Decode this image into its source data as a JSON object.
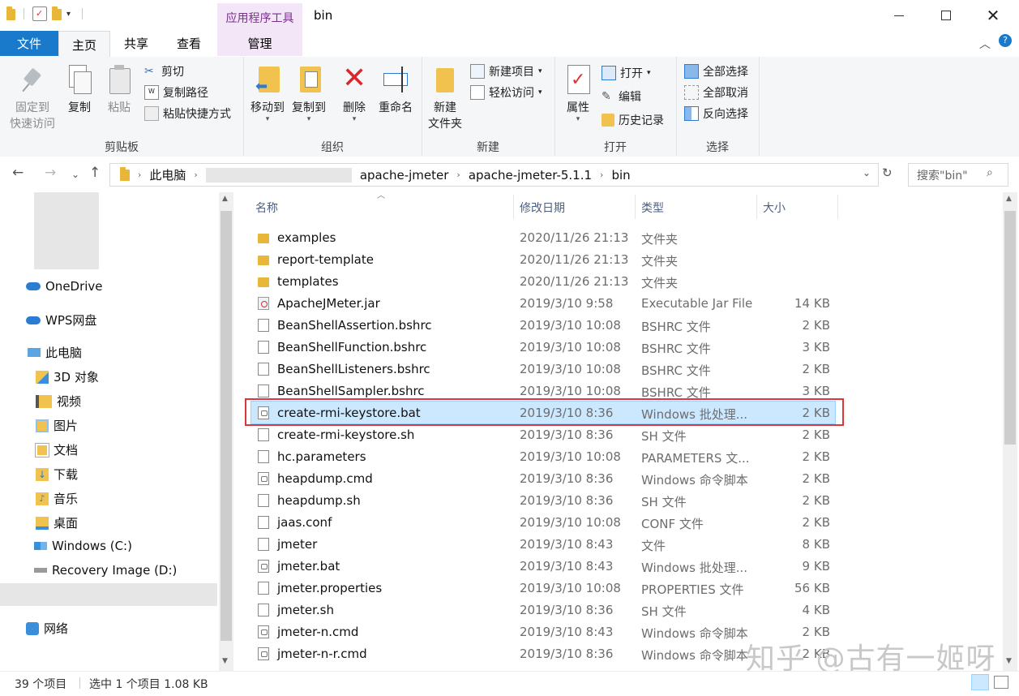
{
  "title": "bin",
  "ribbon_context_tab": "应用程序工具",
  "tabs": {
    "file": "文件",
    "home": "主页",
    "share": "共享",
    "view": "查看",
    "manage": "管理"
  },
  "ribbon": {
    "clipboard": {
      "label": "剪贴板",
      "pin": "固定到\n快速访问",
      "pin_line1": "固定到",
      "pin_line2": "快速访问",
      "copy": "复制",
      "paste": "粘贴",
      "cut": "剪切",
      "copy_path": "复制路径",
      "paste_shortcut": "粘贴快捷方式"
    },
    "organize": {
      "label": "组织",
      "move_to": "移动到",
      "copy_to": "复制到",
      "delete": "删除",
      "rename": "重命名"
    },
    "new": {
      "label": "新建",
      "new_folder_line1": "新建",
      "new_folder_line2": "文件夹",
      "new_item": "新建项目",
      "easy_access": "轻松访问"
    },
    "open": {
      "label": "打开",
      "properties": "属性",
      "open": "打开",
      "edit": "编辑",
      "history": "历史记录"
    },
    "select": {
      "label": "选择",
      "select_all": "全部选择",
      "select_none": "全部取消",
      "invert": "反向选择"
    }
  },
  "address": {
    "segments": [
      "此电脑",
      "apache-jmeter",
      "apache-jmeter-5.1.1",
      "bin"
    ],
    "search_placeholder": "搜索\"bin\""
  },
  "nav": {
    "items": [
      {
        "label": "OneDrive",
        "icon": "cloud-icon"
      },
      {
        "label": "WPS网盘",
        "icon": "cloud-icon"
      },
      {
        "label": "此电脑",
        "icon": "computer-icon"
      },
      {
        "label": "3D 对象",
        "icon": "3d-objects-icon"
      },
      {
        "label": "视频",
        "icon": "video-icon"
      },
      {
        "label": "图片",
        "icon": "pictures-icon"
      },
      {
        "label": "文档",
        "icon": "documents-icon"
      },
      {
        "label": "下载",
        "icon": "download-icon"
      },
      {
        "label": "音乐",
        "icon": "music-icon"
      },
      {
        "label": "桌面",
        "icon": "desktop-icon"
      },
      {
        "label": "Windows (C:)",
        "icon": "drive-icon"
      },
      {
        "label": "Recovery Image (D:)",
        "icon": "drive-icon"
      },
      {
        "label": "网络",
        "icon": "network-icon"
      }
    ]
  },
  "columns": {
    "name": "名称",
    "date": "修改日期",
    "type": "类型",
    "size": "大小"
  },
  "files": [
    {
      "name": "examples",
      "date": "2020/11/26 21:13",
      "type": "文件夹",
      "size": "",
      "icon": "folder"
    },
    {
      "name": "report-template",
      "date": "2020/11/26 21:13",
      "type": "文件夹",
      "size": "",
      "icon": "folder"
    },
    {
      "name": "templates",
      "date": "2020/11/26 21:13",
      "type": "文件夹",
      "size": "",
      "icon": "folder"
    },
    {
      "name": "ApacheJMeter.jar",
      "date": "2019/3/10 9:58",
      "type": "Executable Jar File",
      "size": "14 KB",
      "icon": "jar"
    },
    {
      "name": "BeanShellAssertion.bshrc",
      "date": "2019/3/10 10:08",
      "type": "BSHRC 文件",
      "size": "2 KB",
      "icon": "file"
    },
    {
      "name": "BeanShellFunction.bshrc",
      "date": "2019/3/10 10:08",
      "type": "BSHRC 文件",
      "size": "3 KB",
      "icon": "file"
    },
    {
      "name": "BeanShellListeners.bshrc",
      "date": "2019/3/10 10:08",
      "type": "BSHRC 文件",
      "size": "2 KB",
      "icon": "file"
    },
    {
      "name": "BeanShellSampler.bshrc",
      "date": "2019/3/10 10:08",
      "type": "BSHRC 文件",
      "size": "3 KB",
      "icon": "file"
    },
    {
      "name": "create-rmi-keystore.bat",
      "date": "2019/3/10 8:36",
      "type": "Windows 批处理...",
      "size": "2 KB",
      "icon": "bat",
      "selected": true
    },
    {
      "name": "create-rmi-keystore.sh",
      "date": "2019/3/10 8:36",
      "type": "SH 文件",
      "size": "2 KB",
      "icon": "file"
    },
    {
      "name": "hc.parameters",
      "date": "2019/3/10 10:08",
      "type": "PARAMETERS 文...",
      "size": "2 KB",
      "icon": "file"
    },
    {
      "name": "heapdump.cmd",
      "date": "2019/3/10 8:36",
      "type": "Windows 命令脚本",
      "size": "2 KB",
      "icon": "bat"
    },
    {
      "name": "heapdump.sh",
      "date": "2019/3/10 8:36",
      "type": "SH 文件",
      "size": "2 KB",
      "icon": "file"
    },
    {
      "name": "jaas.conf",
      "date": "2019/3/10 10:08",
      "type": "CONF 文件",
      "size": "2 KB",
      "icon": "file"
    },
    {
      "name": "jmeter",
      "date": "2019/3/10 8:43",
      "type": "文件",
      "size": "8 KB",
      "icon": "file"
    },
    {
      "name": "jmeter.bat",
      "date": "2019/3/10 8:43",
      "type": "Windows 批处理...",
      "size": "9 KB",
      "icon": "bat"
    },
    {
      "name": "jmeter.properties",
      "date": "2019/3/10 10:08",
      "type": "PROPERTIES 文件",
      "size": "56 KB",
      "icon": "file"
    },
    {
      "name": "jmeter.sh",
      "date": "2019/3/10 8:36",
      "type": "SH 文件",
      "size": "4 KB",
      "icon": "file"
    },
    {
      "name": "jmeter-n.cmd",
      "date": "2019/3/10 8:43",
      "type": "Windows 命令脚本",
      "size": "2 KB",
      "icon": "bat"
    },
    {
      "name": "jmeter-n-r.cmd",
      "date": "2019/3/10 8:36",
      "type": "Windows 命令脚本",
      "size": "2 KB",
      "icon": "bat"
    }
  ],
  "status": {
    "count": "39 个项目",
    "selected": "选中 1 个项目 1.08 KB"
  },
  "watermark": "知乎 @古有一姬呀",
  "colors": {
    "accent": "#1979ca",
    "selection": "#cce8ff",
    "highlight_border": "#d9383a",
    "context_tab": "#f3e6f7"
  }
}
